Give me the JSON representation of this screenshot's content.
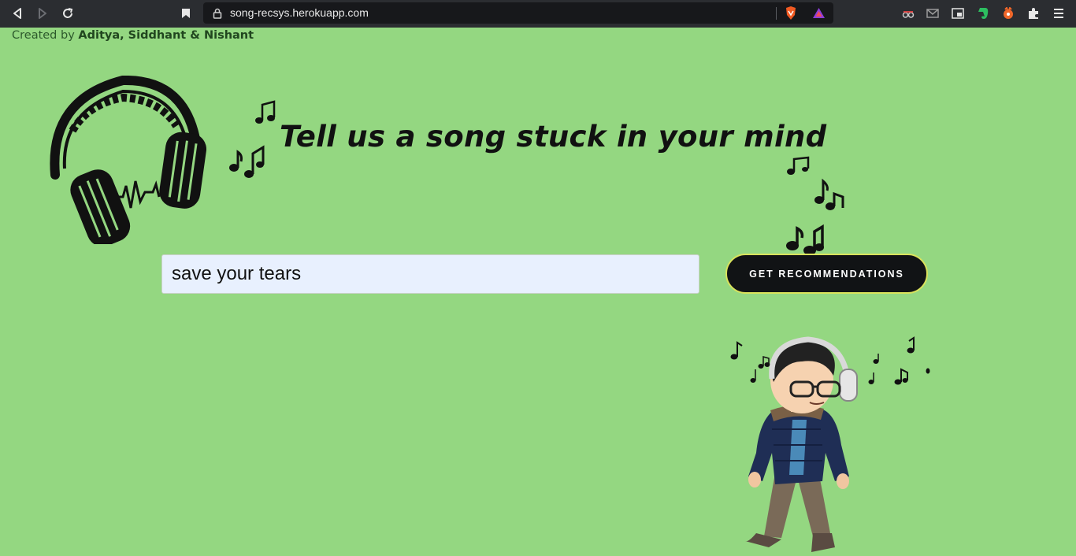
{
  "browser": {
    "url": "song-recsys.herokuapp.com"
  },
  "page": {
    "credits_prefix": "Created by ",
    "credits_names": "Aditya, Siddhant & Nishant",
    "headline": "Tell us a song stuck in your mind",
    "search_value": "save your tears",
    "button_label": "GET RECOMMENDATIONS"
  }
}
